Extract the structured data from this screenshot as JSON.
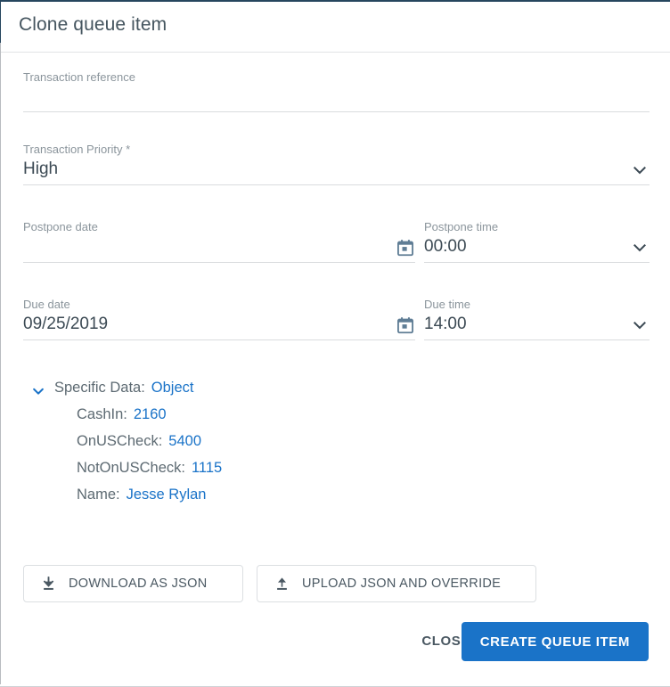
{
  "dialog": {
    "title": "Clone queue item"
  },
  "colors": {
    "accent": "#1a73c8",
    "label": "#8b959c",
    "value": "#3c4a54",
    "rule": "#d9dcde",
    "chrome": "#26465e"
  },
  "form": {
    "transaction_reference": {
      "label": "Transaction reference",
      "value": "",
      "placeholder": ""
    },
    "transaction_priority": {
      "label": "Transaction Priority *",
      "value": "High",
      "icon": "chevron-down-icon"
    },
    "postpone_date": {
      "label": "Postpone date",
      "value": "",
      "icon": "calendar-icon"
    },
    "postpone_time": {
      "label": "Postpone time",
      "value": "00:00",
      "icon": "chevron-down-icon"
    },
    "due_date": {
      "label": "Due date",
      "value": "09/25/2019",
      "icon": "calendar-icon"
    },
    "due_time": {
      "label": "Due time",
      "value": "14:00",
      "icon": "chevron-down-icon"
    }
  },
  "specific_data": {
    "caret_icon": "chevron-down-icon",
    "root_key": "Specific Data:",
    "root_value": "Object",
    "entries": [
      {
        "key": "CashIn:",
        "value": "2160"
      },
      {
        "key": "OnUSCheck:",
        "value": "5400"
      },
      {
        "key": "NotOnUSCheck:",
        "value": "1115"
      },
      {
        "key": "Name:",
        "value": "Jesse Rylan"
      }
    ]
  },
  "json_actions": {
    "download": {
      "label": "DOWNLOAD AS JSON",
      "icon": "download-icon"
    },
    "upload": {
      "label": "UPLOAD JSON AND OVERRIDE",
      "icon": "upload-icon"
    }
  },
  "footer": {
    "close_label": "CLOSE",
    "create_label": "CREATE QUEUE ITEM"
  }
}
